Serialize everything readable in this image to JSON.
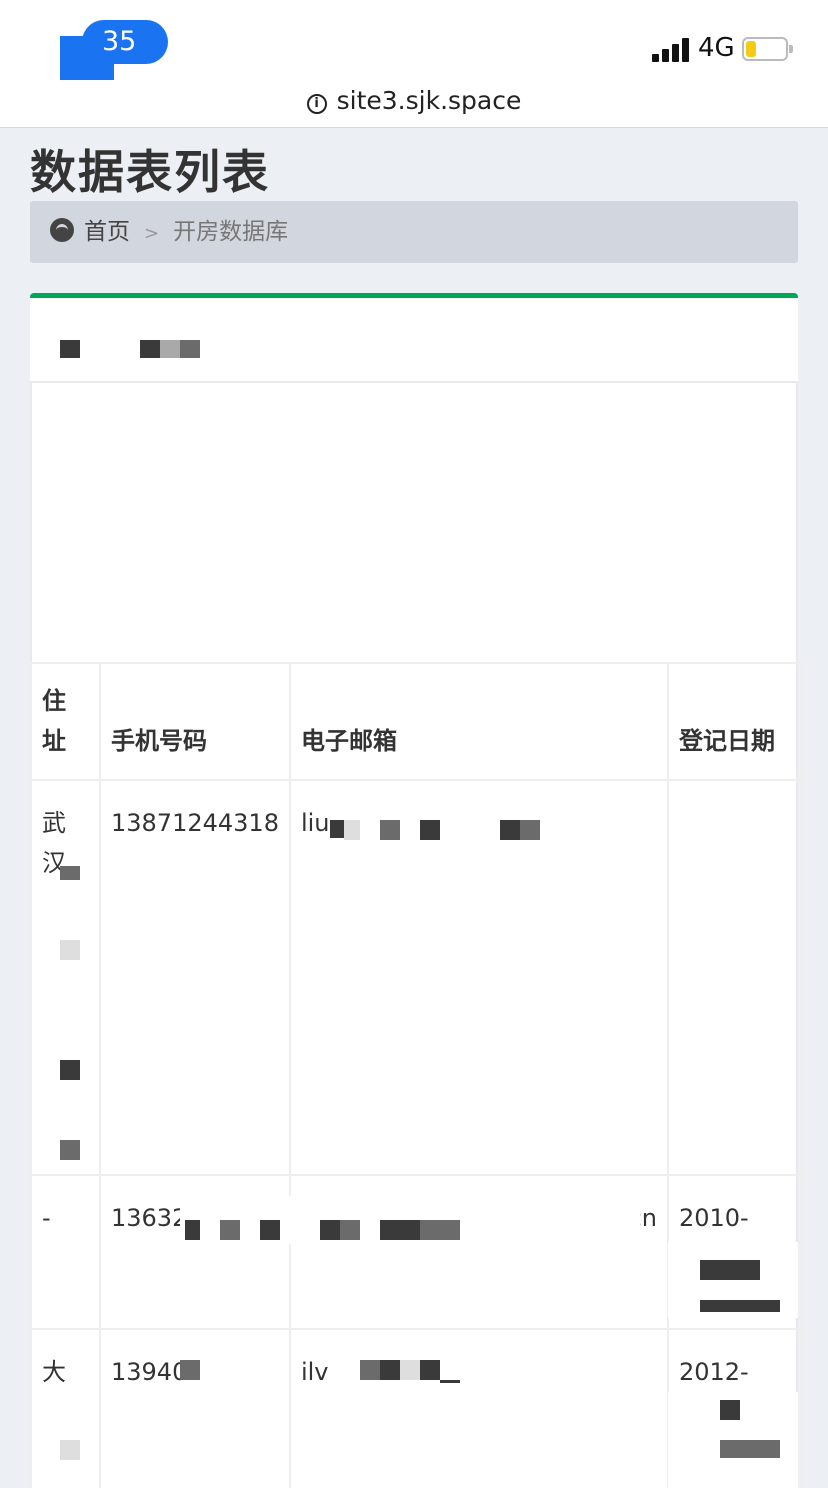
{
  "status_bar": {
    "notification_count": "35",
    "network": "4G",
    "battery_color": "#f7cb15"
  },
  "browser": {
    "url": "site3.sjk.space"
  },
  "page": {
    "title": "数据表列表"
  },
  "breadcrumb": {
    "home": "首页",
    "separator": ">",
    "current": "开房数据库"
  },
  "colors": {
    "accent": "#00a65a",
    "badge": "#1a73f0"
  },
  "table": {
    "headers": [
      "住址",
      "手机号码",
      "电子邮箱",
      "登记日期"
    ],
    "rows": [
      [
        "武汉",
        "13871244318",
        "liu",
        ""
      ],
      [
        "-",
        "13632",
        "m.cn",
        "2010-"
      ],
      [
        "大",
        "13940",
        "ilv",
        "2012-"
      ]
    ]
  }
}
